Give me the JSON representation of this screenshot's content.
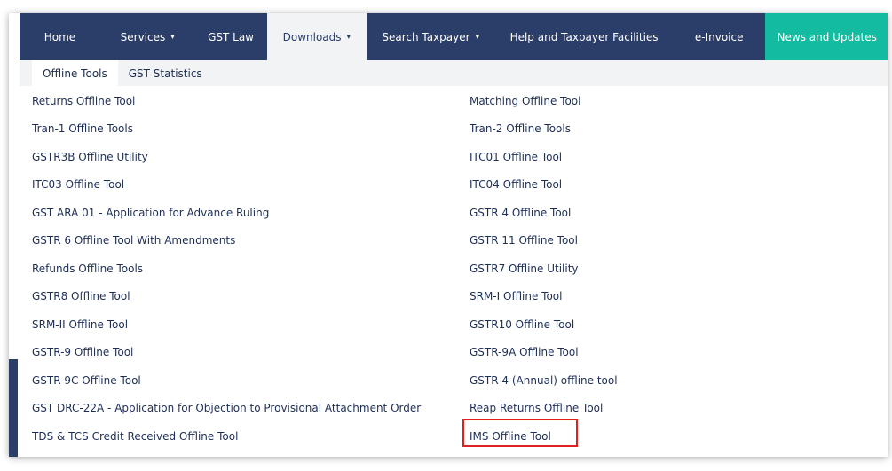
{
  "nav": {
    "items": [
      {
        "label": "Home",
        "caret": ""
      },
      {
        "label": "Services",
        "caret": "▾"
      },
      {
        "label": "GST Law",
        "caret": ""
      },
      {
        "label": "Downloads",
        "caret": "▾"
      },
      {
        "label": "Search Taxpayer",
        "caret": "▾"
      },
      {
        "label": "Help and Taxpayer Facilities",
        "caret": ""
      },
      {
        "label": "e-Invoice",
        "caret": ""
      },
      {
        "label": "News and Updates",
        "caret": ""
      }
    ]
  },
  "subnav": {
    "tabs": [
      "Offline Tools",
      "GST Statistics"
    ]
  },
  "tools": {
    "left": [
      "Returns Offline Tool",
      "Tran-1 Offline Tools",
      "GSTR3B Offline Utility",
      "ITC03 Offline Tool",
      "GST ARA 01 - Application for Advance Ruling",
      "GSTR 6 Offline Tool With Amendments",
      "Refunds Offline Tools",
      "GSTR8 Offline Tool",
      "SRM-II Offline Tool",
      "GSTR-9 Offline Tool",
      "GSTR-9C Offline Tool",
      "GST DRC-22A - Application for Objection to Provisional Attachment Order",
      "TDS & TCS Credit Received Offline Tool"
    ],
    "right": [
      "Matching Offline Tool",
      "Tran-2 Offline Tools",
      "ITC01 Offline Tool",
      "ITC04 Offline Tool",
      "GSTR 4 Offline Tool",
      "GSTR 11 Offline Tool",
      "GSTR7 Offline Utility",
      "SRM-I Offline Tool",
      "GSTR10 Offline Tool",
      "GSTR-9A Offline Tool",
      "GSTR-4 (Annual) offline tool",
      "Reap Returns Offline Tool",
      "IMS Offline Tool"
    ]
  },
  "colors": {
    "navbar": "#2b3d69",
    "active_tab": "#f1f3f5",
    "news_tab": "#13bba0",
    "link_text": "#1e2f57",
    "highlight_border": "#e02020"
  }
}
